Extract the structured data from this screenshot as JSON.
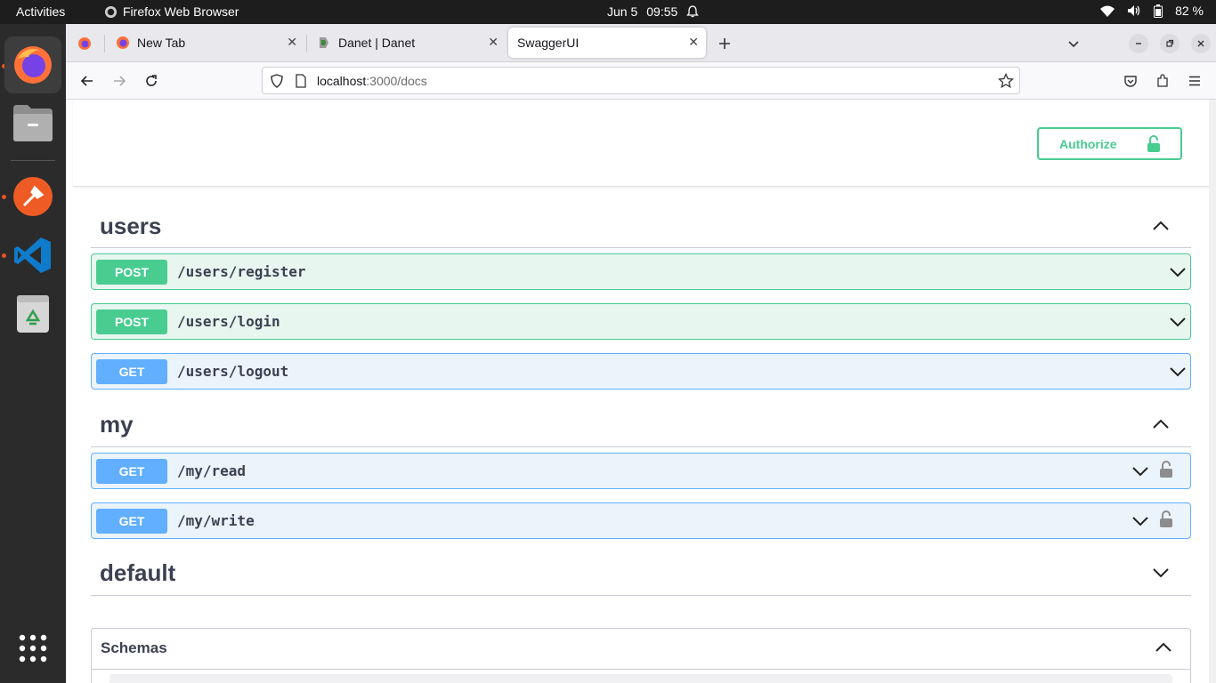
{
  "system": {
    "activities": "Activities",
    "app_name": "Firefox Web Browser",
    "date": "Jun 5",
    "time": "09:55",
    "battery": "82 %"
  },
  "browser": {
    "tabs": [
      {
        "label": "New Tab"
      },
      {
        "label": "Danet | Danet"
      },
      {
        "label": "SwaggerUI"
      }
    ],
    "url_host": "localhost",
    "url_rest": ":3000/docs"
  },
  "swagger": {
    "authorize_label": "Authorize",
    "sections": [
      {
        "name": "users",
        "operations": [
          {
            "method": "POST",
            "path": "/users/register"
          },
          {
            "method": "POST",
            "path": "/users/login"
          },
          {
            "method": "GET",
            "path": "/users/logout"
          }
        ]
      },
      {
        "name": "my",
        "operations": [
          {
            "method": "GET",
            "path": "/my/read"
          },
          {
            "method": "GET",
            "path": "/my/write"
          }
        ]
      },
      {
        "name": "default",
        "operations": []
      }
    ],
    "schemas_label": "Schemas"
  },
  "colors": {
    "post": "#49cc90",
    "get": "#61affe",
    "text": "#3b4151"
  }
}
